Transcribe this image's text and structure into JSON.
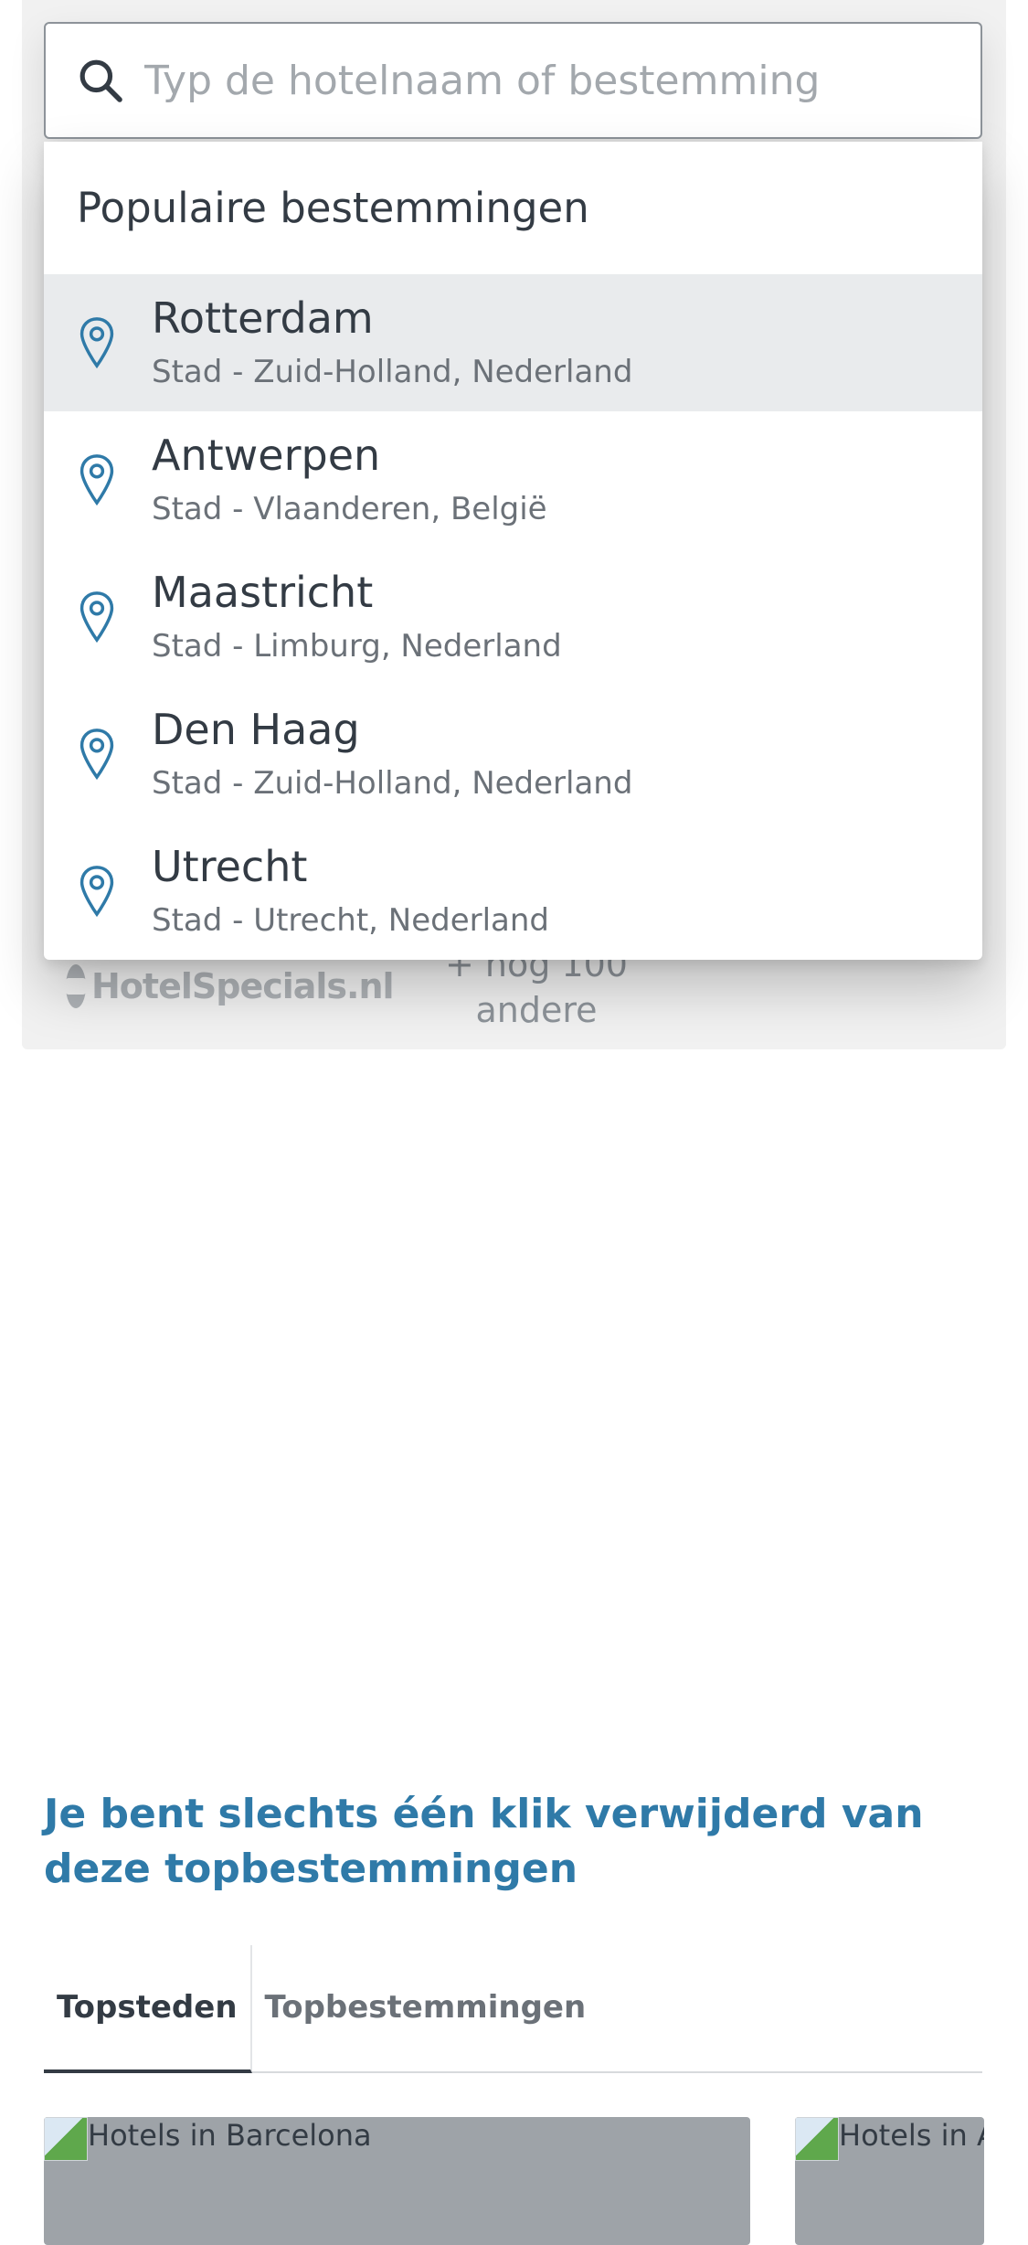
{
  "search": {
    "placeholder": "Typ de hotelnaam of bestemming"
  },
  "dropdown": {
    "heading": "Populaire bestemmingen",
    "items": [
      {
        "title": "Rotterdam",
        "subtitle": "Stad - Zuid-Holland, Nederland"
      },
      {
        "title": "Antwerpen",
        "subtitle": "Stad - Vlaanderen, België"
      },
      {
        "title": "Maastricht",
        "subtitle": "Stad - Limburg, Nederland"
      },
      {
        "title": "Den Haag",
        "subtitle": "Stad - Zuid-Holland, Nederland"
      },
      {
        "title": "Utrecht",
        "subtitle": "Stad - Utrecht, Nederland"
      }
    ]
  },
  "partners": {
    "logo_text": "HotelSpecials.nl",
    "more_text": "+ nog 100 andere"
  },
  "destinations": {
    "headline": "Je bent slechts één klik verwijderd van deze topbestemmingen",
    "tabs": [
      {
        "label": "Topsteden"
      },
      {
        "label": "Topbestemmingen"
      }
    ],
    "cards": [
      {
        "alt": "Hotels in Barcelona"
      },
      {
        "alt": "Hotels in A"
      }
    ]
  },
  "colors": {
    "accent": "#2f7aa8",
    "pin": "#2f7aa8",
    "active_row": "#e9ebed"
  },
  "icons": {
    "search": "search-icon",
    "pin": "map-pin-icon"
  }
}
